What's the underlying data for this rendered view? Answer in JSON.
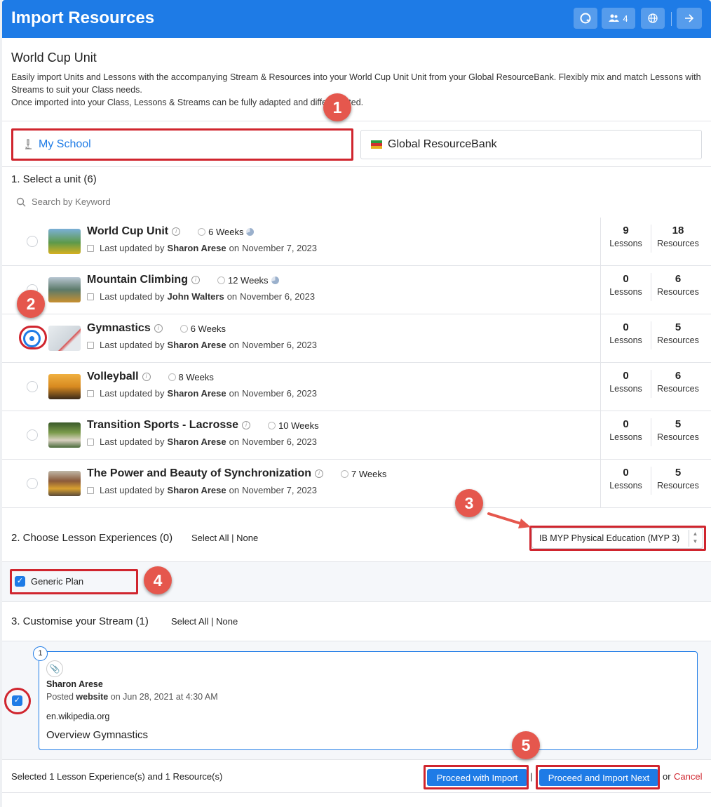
{
  "header": {
    "title": "Import Resources",
    "users_count": "4"
  },
  "intro": {
    "unit_title": "World Cup Unit",
    "description_line1": "Easily import Units and Lessons with the accompanying Stream & Resources into your World Cup Unit Unit from your Global ResourceBank. Flexibly mix and match Lessons with Streams to suit your Class needs.",
    "description_line2": "Once imported into your Class, Lessons & Streams can be fully adapted and differentiated."
  },
  "sources": {
    "my_school": "My School",
    "global": "Global ResourceBank"
  },
  "units_section": {
    "title": "1. Select a unit (6)",
    "search_placeholder": "Search by Keyword",
    "updated_prefix": "Last updated by",
    "on": "on",
    "lessons_label": "Lessons",
    "resources_label": "Resources",
    "units": [
      {
        "name": "World Cup Unit",
        "weeks": "6 Weeks",
        "author": "Sharon Arese",
        "date": "November 7, 2023",
        "lessons": "9",
        "resources": "18",
        "selected": false
      },
      {
        "name": "Mountain Climbing",
        "weeks": "12 Weeks",
        "author": "John Walters",
        "date": "November 6, 2023",
        "lessons": "0",
        "resources": "6",
        "selected": false
      },
      {
        "name": "Gymnastics",
        "weeks": "6 Weeks",
        "author": "Sharon Arese",
        "date": "November 6, 2023",
        "lessons": "0",
        "resources": "5",
        "selected": true
      },
      {
        "name": "Volleyball",
        "weeks": "8 Weeks",
        "author": "Sharon Arese",
        "date": "November 6, 2023",
        "lessons": "0",
        "resources": "6",
        "selected": false
      },
      {
        "name": "Transition Sports - Lacrosse",
        "weeks": "10 Weeks",
        "author": "Sharon Arese",
        "date": "November 6, 2023",
        "lessons": "0",
        "resources": "5",
        "selected": false
      },
      {
        "name": "The Power and Beauty of Synchronization",
        "weeks": "7 Weeks",
        "author": "Sharon Arese",
        "date": "November 7, 2023",
        "lessons": "0",
        "resources": "5",
        "selected": false
      }
    ]
  },
  "lessons_section": {
    "title": "2. Choose Lesson Experiences (0)",
    "select_all": "Select All",
    "divider": "|",
    "none": "None",
    "curriculum_selected": "IB MYP Physical Education (MYP 3)",
    "plan_label": "Generic Plan"
  },
  "stream_section": {
    "title": "3. Customise your Stream (1)",
    "select_all": "Select All",
    "divider": "|",
    "none": "None",
    "item": {
      "number": "1",
      "author": "Sharon Arese",
      "posted_prefix": "Posted",
      "source": "website",
      "posted_suffix": "on Jun 28, 2021 at 4:30 AM",
      "domain": "en.wikipedia.org",
      "title": "Overview Gymnastics"
    }
  },
  "footer": {
    "summary": "Selected 1 Lesson Experience(s) and 1 Resource(s)",
    "proceed": "Proceed with Import",
    "divider": "|",
    "proceed_next": "Proceed and Import Next",
    "or": "or",
    "cancel": "Cancel"
  },
  "annotations": [
    "1",
    "2",
    "3",
    "4",
    "5"
  ],
  "colors": {
    "primary": "#1e7be6",
    "highlight": "#d0252e",
    "marker": "#e5574d",
    "cancel": "#d0252e"
  }
}
